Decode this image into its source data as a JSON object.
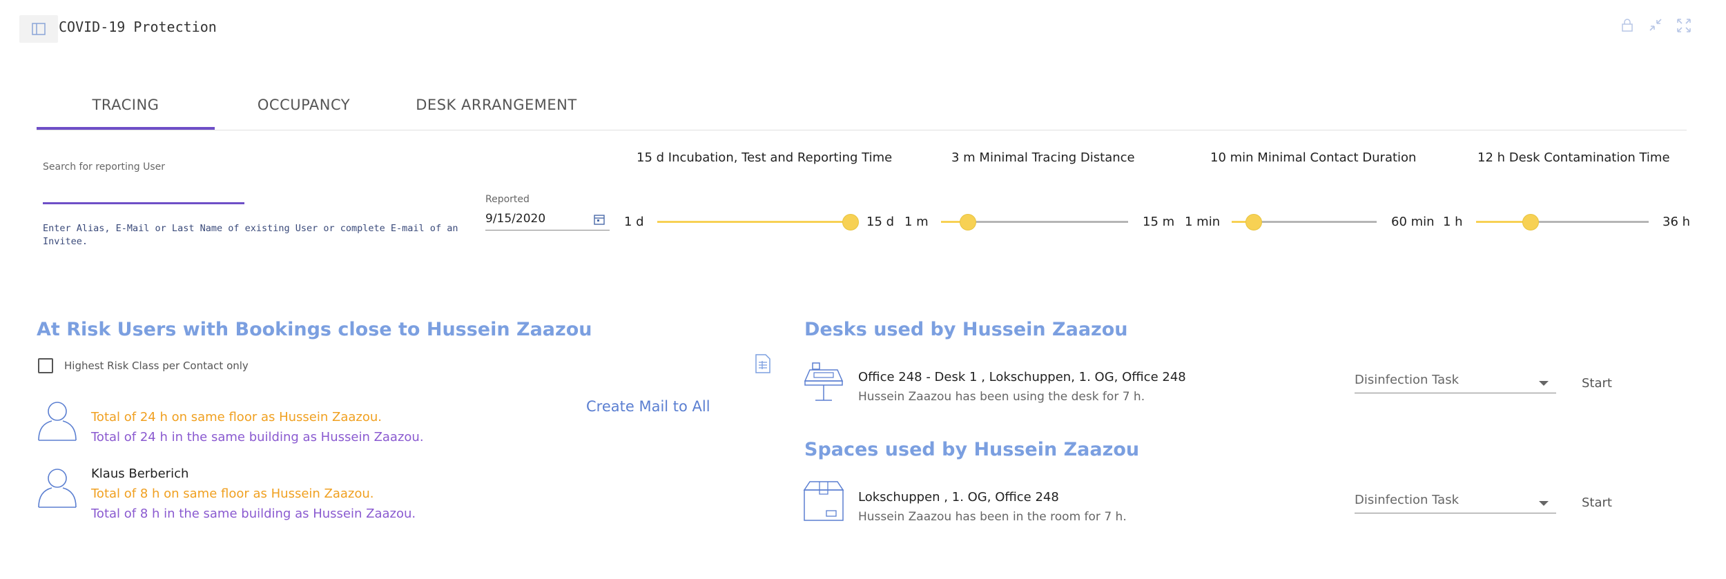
{
  "header": {
    "title": "COVID-19 Protection",
    "icons": [
      "sidebar-icon",
      "lock-icon",
      "collapse-icon",
      "expand-icon"
    ]
  },
  "tabs": [
    {
      "label": "TRACING",
      "active": true
    },
    {
      "label": "OCCUPANCY",
      "active": false
    },
    {
      "label": "DESK ARRANGEMENT",
      "active": false
    }
  ],
  "search": {
    "label": "Search for reporting User",
    "value": "",
    "hint": "Enter Alias, E-Mail or Last Name of existing User or complete E-mail of an Invitee."
  },
  "reported": {
    "label": "Reported",
    "value": "9/15/2020"
  },
  "sliders": [
    {
      "title": "15 d Incubation, Test and Reporting Time",
      "min_label": "1 d",
      "max_label": "15 d",
      "min": 1,
      "max": 15,
      "value": 15
    },
    {
      "title": "3 m Minimal Tracing Distance",
      "min_label": "1 m",
      "max_label": "15 m",
      "min": 1,
      "max": 15,
      "value": 3
    },
    {
      "title": "10 min Minimal Contact Duration",
      "min_label": "1 min",
      "max_label": "60 min",
      "min": 1,
      "max": 60,
      "value": 10
    },
    {
      "title": "12 h Desk Contamination Time",
      "min_label": "1 h",
      "max_label": "36 h",
      "min": 1,
      "max": 36,
      "value": 12
    }
  ],
  "risk": {
    "title": "At Risk Users with Bookings close to Hussein Zaazou",
    "checkbox_label": "Highest Risk Class per Contact only",
    "checkbox_checked": false,
    "mail_all": "Create Mail to All",
    "users": [
      {
        "name": "",
        "floor": "Total of 24 h on same floor as Hussein Zaazou.",
        "building": "Total of 24 h in the same building as Hussein Zaazou."
      },
      {
        "name": "Klaus Berberich",
        "floor": "Total of 8 h on same floor as Hussein Zaazou.",
        "building": "Total of 8 h in the same building as Hussein Zaazou."
      }
    ]
  },
  "desks": {
    "title": "Desks used by Hussein Zaazou",
    "items": [
      {
        "title": "Office 248 - Desk 1 , Lokschuppen, 1. OG, Office 248",
        "subtitle": "Hussein Zaazou has been using the desk for 7 h.",
        "task": "Disinfection Task",
        "action": "Start"
      }
    ]
  },
  "spaces": {
    "title": "Spaces used by Hussein Zaazou",
    "items": [
      {
        "title": "Lokschuppen , 1. OG, Office 248",
        "subtitle": "Hussein Zaazou has been in the room for 7 h.",
        "task": "Disinfection Task",
        "action": "Start"
      }
    ]
  },
  "colors": {
    "accent": "#6e4fc7",
    "slider": "#f7d154",
    "section_title": "#7b9fe0",
    "orange": "#f0a020",
    "purple": "#8a5ad0"
  }
}
